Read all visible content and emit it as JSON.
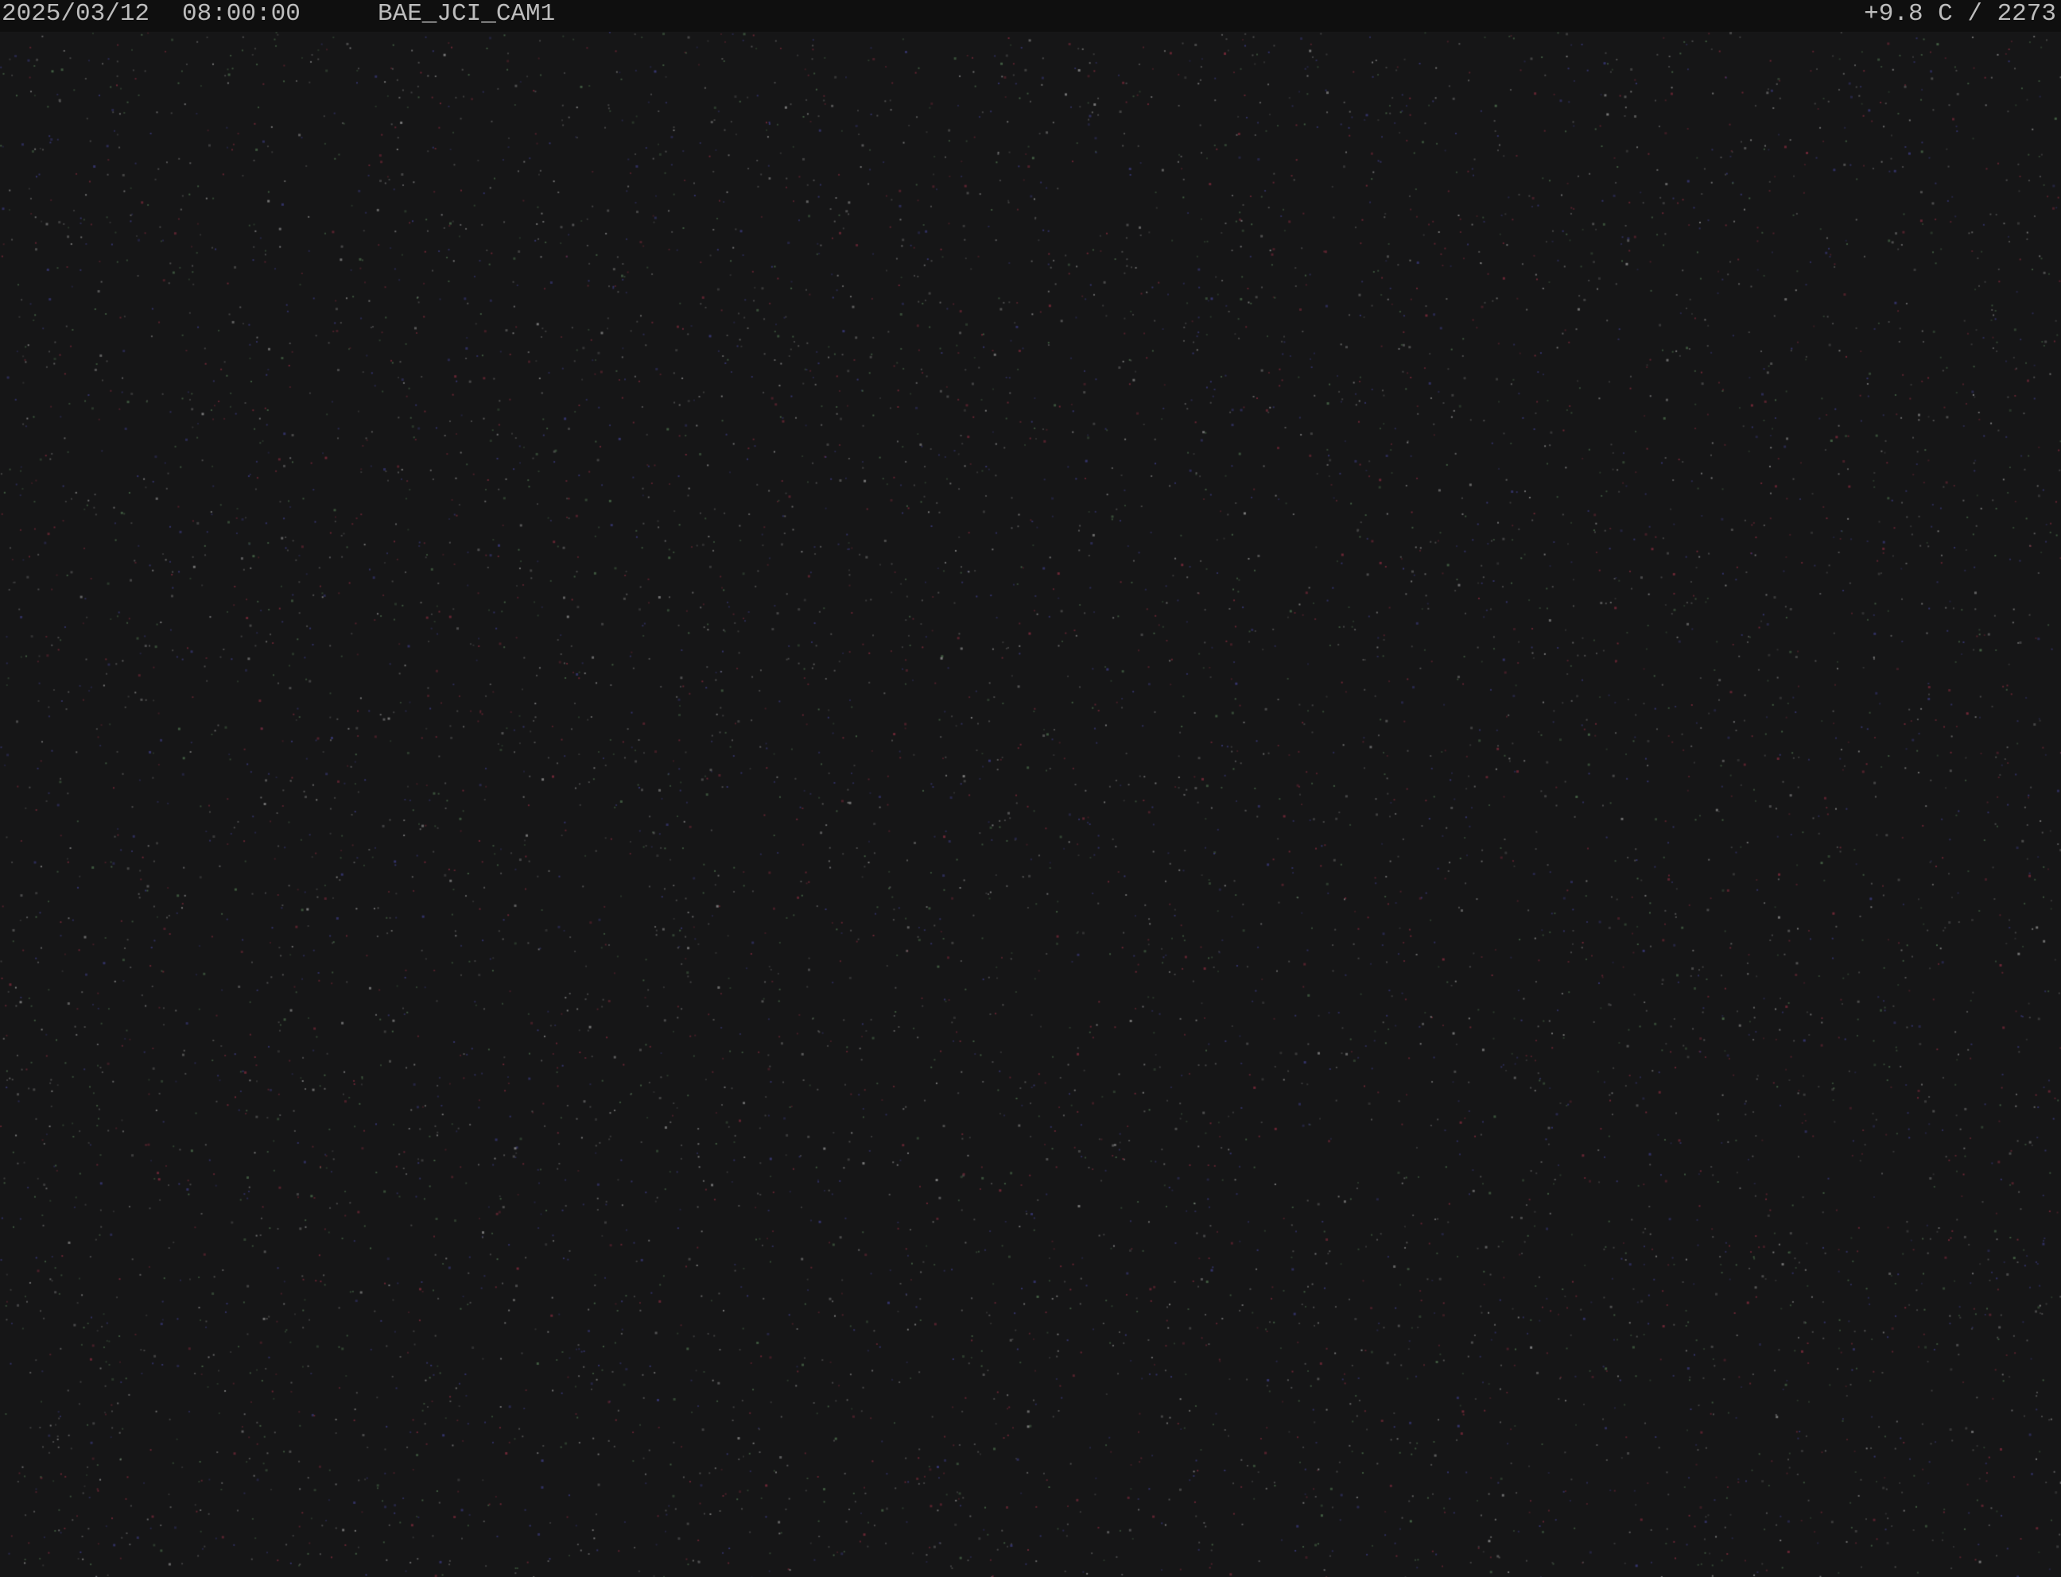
{
  "overlay": {
    "date": "2025/03/12",
    "time": "08:00:00",
    "camera_id": "BAE_JCI_CAM1",
    "telemetry": "+9.8 C / 2273"
  },
  "scene": {
    "description_kind": "night-sky-star-field",
    "background_color": "#161617",
    "overlay_bar_color": "#0f0f0f",
    "text_color": "#bdbdbd",
    "noise_colors": [
      "#5a5a5a",
      "#7a2a3a",
      "#3a3a7a",
      "#4a6a4a",
      "#8a8a8a"
    ]
  }
}
